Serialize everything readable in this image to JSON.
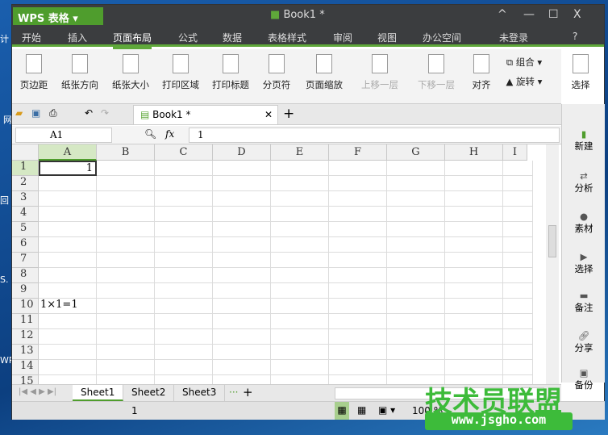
{
  "app": {
    "brand": "WPS 表格",
    "doc_title": "Book1 *"
  },
  "desktop_labels": [
    "计",
    "网",
    "回",
    "S.",
    "WPS"
  ],
  "menu": {
    "tabs": [
      "开始",
      "插入",
      "页面布局",
      "公式",
      "数据",
      "表格样式",
      "审阅",
      "视图",
      "办公空间"
    ],
    "active": "页面布局",
    "login": "未登录",
    "help": "?"
  },
  "ribbon": {
    "buttons": [
      "页边距",
      "纸张方向",
      "纸张大小",
      "打印区域",
      "打印标题",
      "分页符",
      "页面缩放",
      "上移一层",
      "下移一层",
      "对齐",
      "组合",
      "旋转",
      "选择"
    ]
  },
  "doc_tab": {
    "label": "Book1 *",
    "add": "+"
  },
  "formula": {
    "name_box": "A1",
    "fx": "fx",
    "value": "1"
  },
  "columns": [
    "A",
    "B",
    "C",
    "D",
    "E",
    "F",
    "G",
    "H",
    "I"
  ],
  "rows": [
    "1",
    "2",
    "3",
    "4",
    "5",
    "6",
    "7",
    "8",
    "9",
    "10",
    "11",
    "12",
    "13",
    "14",
    "15"
  ],
  "cells": {
    "A1": "1",
    "A10": "1×1=1"
  },
  "side_panel": [
    "新建",
    "分析",
    "素材",
    "选择",
    "备注",
    "分享",
    "备份"
  ],
  "sheets": {
    "tabs": [
      "Sheet1",
      "Sheet2",
      "Sheet3"
    ],
    "active": "Sheet1",
    "more": "···",
    "add": "+"
  },
  "status": {
    "value": "1",
    "zoom": "100 %"
  },
  "watermark": {
    "title": "技术员联盟",
    "url": "www.jsgho.com"
  }
}
